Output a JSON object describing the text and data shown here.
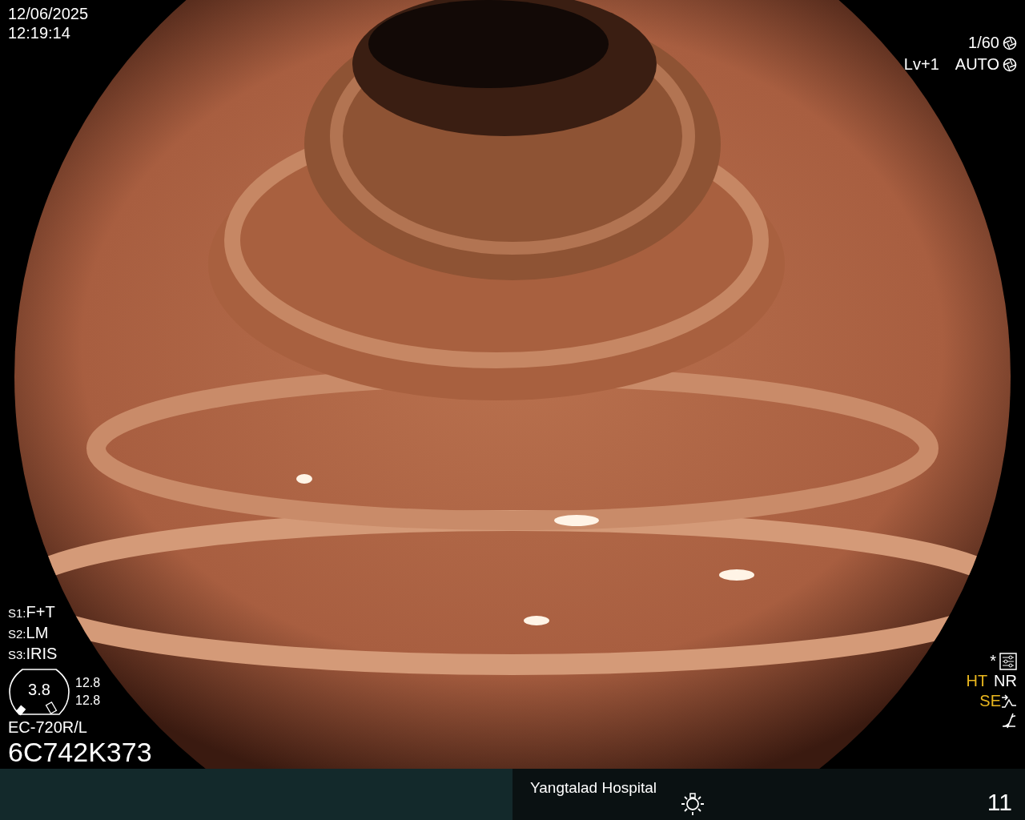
{
  "datetime": {
    "date": "12/06/2025",
    "time": "12:19:14"
  },
  "exposure": {
    "shutter": "1/60",
    "level": "Lv+1",
    "iris": "AUTO"
  },
  "settings": [
    {
      "label": "S1:",
      "value": "F+T"
    },
    {
      "label": "S2:",
      "value": "LM"
    },
    {
      "label": "S3:",
      "value": "IRIS"
    }
  ],
  "gauge": {
    "value": "3.8",
    "reading_1": "12.8",
    "reading_2": "12.8"
  },
  "scope": {
    "model": "EC-720R/L",
    "serial": "6C742K373"
  },
  "indicators": {
    "asterisk": "*",
    "modes": [
      {
        "label": "HT",
        "color": "#eab71e"
      },
      {
        "label": "NR",
        "color": "#ffffff"
      }
    ],
    "edge": {
      "label": "SE",
      "color": "#eab71e"
    }
  },
  "footer": {
    "hospital": "Yangtalad Hospital",
    "number": "11"
  }
}
